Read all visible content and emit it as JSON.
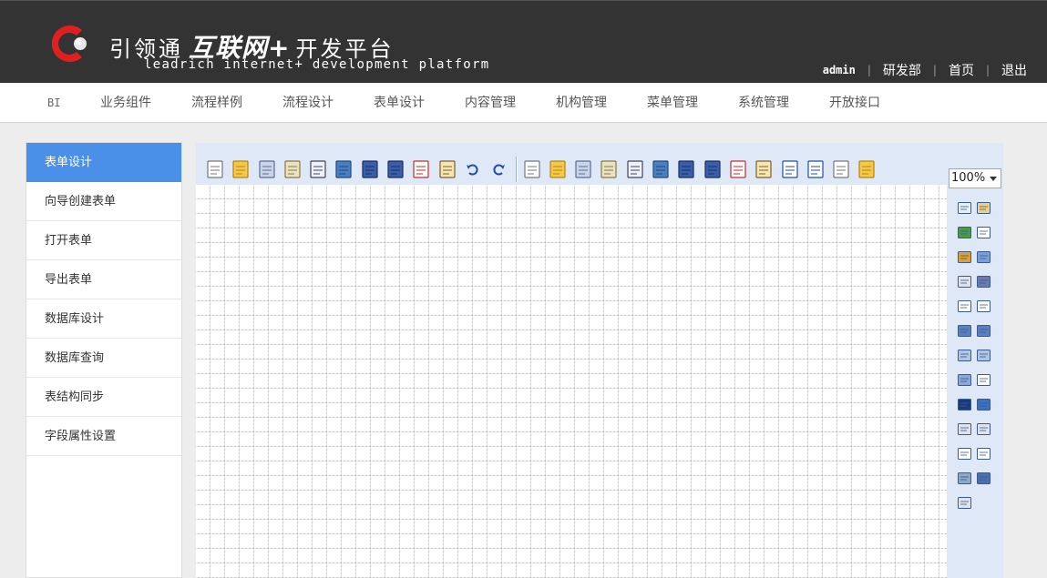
{
  "header": {
    "logo_cn_prefix": "引领通",
    "logo_cn_bold": "互联网+",
    "logo_cn_suffix": "开发平台",
    "logo_en": "leadrich internet+ development platform",
    "user": "admin",
    "links": [
      "研发部",
      "首页",
      "退出"
    ],
    "colors": {
      "background": "#333333",
      "logo_red": "#e02020"
    }
  },
  "nav": {
    "items": [
      "BI",
      "业务组件",
      "流程样例",
      "流程设计",
      "表单设计",
      "内容管理",
      "机构管理",
      "菜单管理",
      "系统管理",
      "开放接口"
    ]
  },
  "sidebar": {
    "active_index": 0,
    "active_color": "#4a8fe8",
    "items": [
      "表单设计",
      "向导创建表单",
      "打开表单",
      "导出表单",
      "数据库设计",
      "数据库查询",
      "表结构同步",
      "字段属性设置"
    ]
  },
  "designer": {
    "zoom": "100%",
    "toolbar_icons": [
      "new-icon",
      "open-icon",
      "copy-icon",
      "print-setup-icon",
      "preview-icon",
      "run-icon",
      "save-icon",
      "save-as-icon",
      "export-icon",
      "paste-icon",
      "undo-icon",
      "redo-icon",
      "align-left-icon",
      "sort-icon",
      "bring-front-icon",
      "send-back-icon",
      "edit-icon",
      "pencil-icon",
      "book-icon",
      "find-icon",
      "new-page-icon",
      "insert-icon",
      "tools-icon",
      "info-icon",
      "list-icon",
      "grid-icon"
    ],
    "palette_icons": [
      "button-icon",
      "label-icon",
      "image-control-icon",
      "textbox-icon",
      "shapes-icon",
      "calendar-icon",
      "group-icon",
      "brush-icon",
      "spinner-icon",
      "option-list-icon",
      "list-box-icon",
      "tree-icon",
      "table-icon",
      "grid-table-icon",
      "column-icon",
      "field-icon",
      "checkbox-icon",
      "radio-icon",
      "combo-icon",
      "combo-list-icon",
      "form-field-icon",
      "report-icon",
      "picture-icon",
      "attachment-icon",
      "panel-icon"
    ]
  }
}
